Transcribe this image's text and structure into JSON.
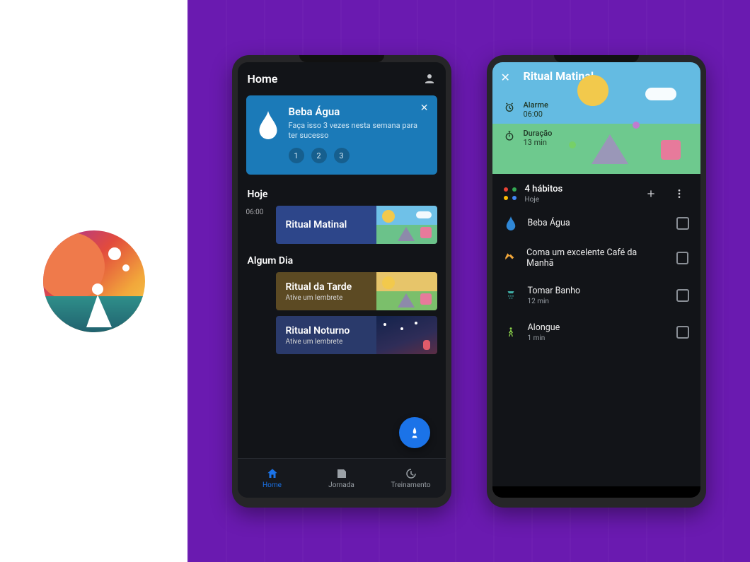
{
  "phone1": {
    "topbar": {
      "title": "Home"
    },
    "blueCard": {
      "title": "Beba Água",
      "subtitle": "Faça isso 3 vezes nesta semana para ter sucesso",
      "steps": [
        "1",
        "2",
        "3"
      ]
    },
    "sectionToday": "Hoje",
    "todayTime": "06:00",
    "todayRitual": {
      "title": "Ritual Matinal"
    },
    "sectionSomeday": "Algum Dia",
    "somedayRituals": [
      {
        "title": "Ritual da Tarde",
        "subtitle": "Ative um lembrete"
      },
      {
        "title": "Ritual Noturno",
        "subtitle": "Ative um lembrete"
      }
    ],
    "nav": {
      "home": "Home",
      "jornada": "Jornada",
      "treinamento": "Treinamento"
    }
  },
  "phone2": {
    "header": {
      "title": "Ritual Matinal",
      "alarmLabel": "Alarme",
      "alarmValue": "06:00",
      "durationLabel": "Duração",
      "durationValue": "13 min"
    },
    "habitsHeader": {
      "title": "4 hábitos",
      "subtitle": "Hoje"
    },
    "habits": [
      {
        "title": "Beba Água",
        "subtitle": ""
      },
      {
        "title": "Coma um excelente Café da Manhã",
        "subtitle": ""
      },
      {
        "title": "Tomar Banho",
        "subtitle": "12 min"
      },
      {
        "title": "Alongue",
        "subtitle": "1 min"
      }
    ]
  }
}
